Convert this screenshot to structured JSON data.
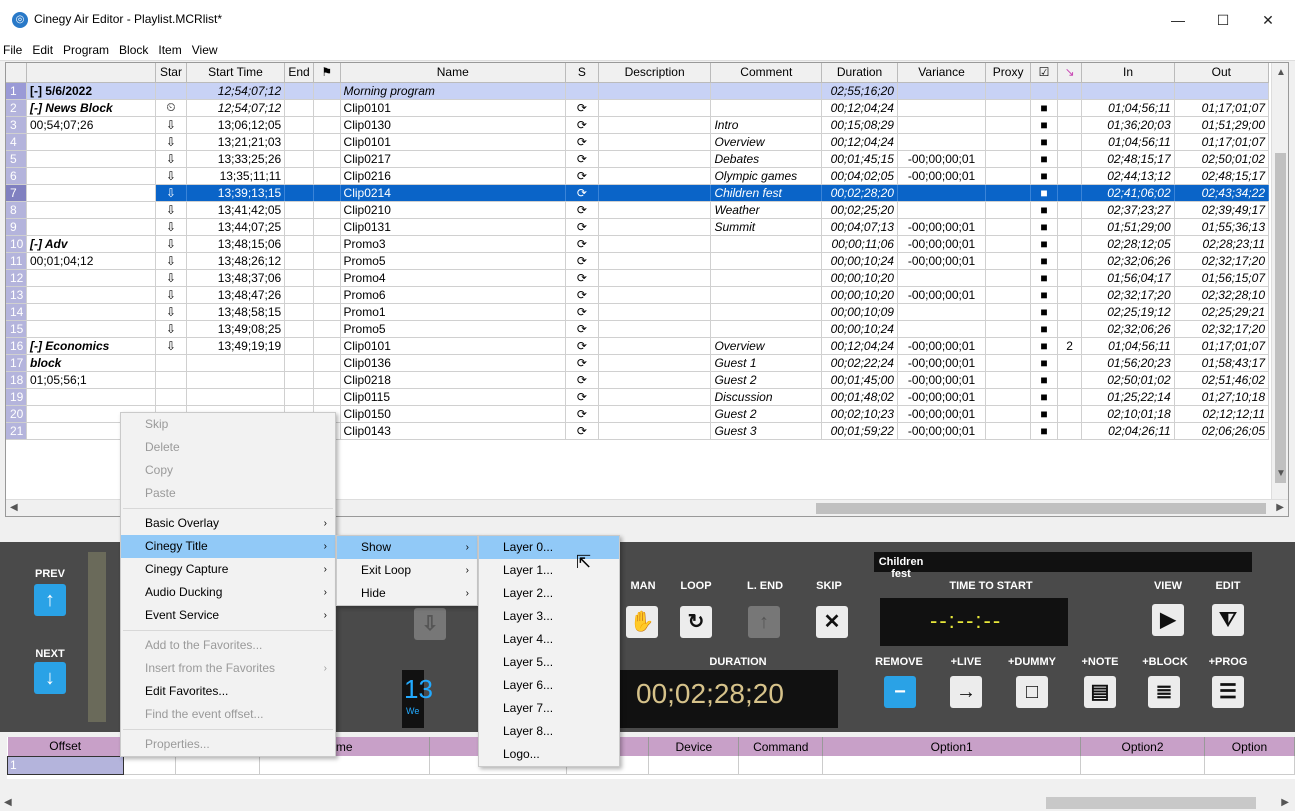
{
  "window": {
    "title": "Cinegy Air Editor - Playlist.MCRlist*",
    "minimize": "—",
    "maximize": "☐",
    "close": "✕"
  },
  "menubar": [
    "File",
    "Edit",
    "Program",
    "Block",
    "Item",
    "View"
  ],
  "columns": [
    "",
    "",
    "Star",
    "Start Time",
    "End",
    "",
    "Name",
    "S",
    "Description",
    "Comment",
    "Duration",
    "Variance",
    "Proxy",
    "☑",
    "",
    "In",
    "Out"
  ],
  "rows": [
    {
      "n": "1",
      "group": "[-] 5/6/2022",
      "star": "",
      "start": "12;54;07;12",
      "name": "Morning program",
      "s": "",
      "comment": "",
      "duration": "02;55;16;20",
      "variance": "",
      "chk": "",
      "ext": "",
      "in": "",
      "out": "",
      "type": "grp"
    },
    {
      "n": "2",
      "group": "[-] News Block",
      "star": "⏲",
      "start": "12;54;07;12",
      "name": "Clip0101",
      "s": "⟳",
      "comment": "",
      "duration": "00;12;04;24",
      "variance": "",
      "chk": "■",
      "ext": "",
      "in": "01;04;56;11",
      "out": "01;17;01;07",
      "type": "first"
    },
    {
      "n": "3",
      "group": "00;54;07;26",
      "star": "⇩",
      "start": "13;06;12;05",
      "name": "Clip0130",
      "s": "⟳",
      "comment": "Intro",
      "duration": "00;15;08;29",
      "variance": "",
      "chk": "■",
      "ext": "",
      "in": "01;36;20;03",
      "out": "01;51;29;00"
    },
    {
      "n": "4",
      "group": "",
      "star": "⇩",
      "start": "13;21;21;03",
      "name": "Clip0101",
      "s": "⟳",
      "comment": "Overview",
      "duration": "00;12;04;24",
      "variance": "",
      "chk": "■",
      "ext": "",
      "in": "01;04;56;11",
      "out": "01;17;01;07"
    },
    {
      "n": "5",
      "group": "",
      "star": "⇩",
      "start": "13;33;25;26",
      "name": "Clip0217",
      "s": "⟳",
      "comment": "Debates",
      "duration": "00;01;45;15",
      "variance": "-00;00;00;01",
      "chk": "■",
      "ext": "",
      "in": "02;48;15;17",
      "out": "02;50;01;02"
    },
    {
      "n": "6",
      "group": "",
      "star": "⇩",
      "start": "13;35;11;11",
      "name": "Clip0216",
      "s": "⟳",
      "comment": "Olympic games",
      "duration": "00;04;02;05",
      "variance": "-00;00;00;01",
      "chk": "■",
      "ext": "",
      "in": "02;44;13;12",
      "out": "02;48;15;17"
    },
    {
      "n": "7",
      "group": "",
      "star": "⇩",
      "start": "13;39;13;15",
      "name": "Clip0214",
      "s": "⟳",
      "comment": "Children fest",
      "duration": "00;02;28;20",
      "variance": "",
      "chk": "■",
      "ext": "",
      "in": "02;41;06;02",
      "out": "02;43;34;22",
      "type": "sel"
    },
    {
      "n": "8",
      "group": "",
      "star": "⇩",
      "start": "13;41;42;05",
      "name": "Clip0210",
      "s": "⟳",
      "comment": "Weather",
      "duration": "00;02;25;20",
      "variance": "",
      "chk": "■",
      "ext": "",
      "in": "02;37;23;27",
      "out": "02;39;49;17"
    },
    {
      "n": "9",
      "group": "",
      "star": "⇩",
      "start": "13;44;07;25",
      "name": "Clip0131",
      "s": "⟳",
      "comment": "Summit",
      "duration": "00;04;07;13",
      "variance": "-00;00;00;01",
      "chk": "■",
      "ext": "",
      "in": "01;51;29;00",
      "out": "01;55;36;13"
    },
    {
      "n": "10",
      "group": "[-] Adv",
      "star": "⇩",
      "start": "13;48;15;06",
      "name": "Promo3",
      "s": "⟳",
      "comment": "",
      "duration": "00;00;11;06",
      "variance": "-00;00;00;01",
      "chk": "■",
      "ext": "",
      "in": "02;28;12;05",
      "out": "02;28;23;11",
      "type": "first"
    },
    {
      "n": "11",
      "group": "00;01;04;12",
      "star": "⇩",
      "start": "13;48;26;12",
      "name": "Promo5",
      "s": "⟳",
      "comment": "",
      "duration": "00;00;10;24",
      "variance": "-00;00;00;01",
      "chk": "■",
      "ext": "",
      "in": "02;32;06;26",
      "out": "02;32;17;20"
    },
    {
      "n": "12",
      "group": "",
      "star": "⇩",
      "start": "13;48;37;06",
      "name": "Promo4",
      "s": "⟳",
      "comment": "",
      "duration": "00;00;10;20",
      "variance": "",
      "chk": "■",
      "ext": "",
      "in": "01;56;04;17",
      "out": "01;56;15;07"
    },
    {
      "n": "13",
      "group": "",
      "star": "⇩",
      "start": "13;48;47;26",
      "name": "Promo6",
      "s": "⟳",
      "comment": "",
      "duration": "00;00;10;20",
      "variance": "-00;00;00;01",
      "chk": "■",
      "ext": "",
      "in": "02;32;17;20",
      "out": "02;32;28;10"
    },
    {
      "n": "14",
      "group": "",
      "star": "⇩",
      "start": "13;48;58;15",
      "name": "Promo1",
      "s": "⟳",
      "comment": "",
      "duration": "00;00;10;09",
      "variance": "",
      "chk": "■",
      "ext": "",
      "in": "02;25;19;12",
      "out": "02;25;29;21"
    },
    {
      "n": "15",
      "group": "",
      "star": "⇩",
      "start": "13;49;08;25",
      "name": "Promo5",
      "s": "⟳",
      "comment": "",
      "duration": "00;00;10;24",
      "variance": "",
      "chk": "■",
      "ext": "",
      "in": "02;32;06;26",
      "out": "02;32;17;20"
    },
    {
      "n": "16",
      "group": "[-] Economics",
      "star": "⇩",
      "start": "13;49;19;19",
      "name": "Clip0101",
      "s": "⟳",
      "comment": "Overview",
      "duration": "00;12;04;24",
      "variance": "-00;00;00;01",
      "chk": "■",
      "ext": "2",
      "in": "01;04;56;11",
      "out": "01;17;01;07",
      "type": "first"
    },
    {
      "n": "17",
      "group": "block",
      "star": "",
      "start": "",
      "name": "Clip0136",
      "s": "⟳",
      "comment": "Guest 1",
      "duration": "00;02;22;24",
      "variance": "-00;00;00;01",
      "chk": "■",
      "ext": "",
      "in": "01;56;20;23",
      "out": "01;58;43;17",
      "type": "first"
    },
    {
      "n": "18",
      "group": "01;05;56;1",
      "star": "",
      "start": "",
      "name": "Clip0218",
      "s": "⟳",
      "comment": "Guest 2",
      "duration": "00;01;45;00",
      "variance": "-00;00;00;01",
      "chk": "■",
      "ext": "",
      "in": "02;50;01;02",
      "out": "02;51;46;02"
    },
    {
      "n": "19",
      "group": "",
      "star": "",
      "start": "",
      "name": "Clip0115",
      "s": "⟳",
      "comment": "Discussion",
      "duration": "00;01;48;02",
      "variance": "-00;00;00;01",
      "chk": "■",
      "ext": "",
      "in": "01;25;22;14",
      "out": "01;27;10;18"
    },
    {
      "n": "20",
      "group": "",
      "star": "",
      "start": "",
      "name": "Clip0150",
      "s": "⟳",
      "comment": "Guest 2",
      "duration": "00;02;10;23",
      "variance": "-00;00;00;01",
      "chk": "■",
      "ext": "",
      "in": "02;10;01;18",
      "out": "02;12;12;11"
    },
    {
      "n": "21",
      "group": "",
      "star": "",
      "start": "",
      "name": "Clip0143",
      "s": "⟳",
      "comment": "Guest 3",
      "duration": "00;01;59;22",
      "variance": "-00;00;00;01",
      "chk": "■",
      "ext": "",
      "in": "02;04;26;11",
      "out": "02;06;26;05"
    }
  ],
  "control": {
    "prev": "PREV",
    "next": "NEXT",
    "time_partial": "13",
    "day_partial": "We",
    "modes": [
      "MAN",
      "LOOP",
      "L. END",
      "SKIP"
    ],
    "current_title": "Children fest",
    "time_to_start_label": "TIME TO START",
    "time_to_start": "--:--:--",
    "duration_label": "DURATION",
    "duration": "00;02;28;20",
    "view": "VIEW",
    "edit": "EDIT",
    "actions": [
      "REMOVE",
      "+LIVE",
      "+DUMMY",
      "+NOTE",
      "+BLOCK",
      "+PROG"
    ]
  },
  "bottom_columns": [
    "Offset",
    "",
    "",
    "me",
    "",
    "",
    "Device",
    "Command",
    "Option1",
    "Option2",
    "Option"
  ],
  "bottom_row": "1",
  "context_menu": {
    "items": [
      {
        "label": "Skip",
        "disabled": true
      },
      {
        "label": "Delete",
        "disabled": true
      },
      {
        "label": "Copy",
        "disabled": true
      },
      {
        "label": "Paste",
        "disabled": true
      },
      {
        "sep": true
      },
      {
        "label": "Basic Overlay",
        "sub": true
      },
      {
        "label": "Cinegy Title",
        "sub": true,
        "hover": true
      },
      {
        "label": "Cinegy Capture",
        "sub": true
      },
      {
        "label": "Audio Ducking",
        "sub": true
      },
      {
        "label": "Event Service",
        "sub": true
      },
      {
        "sep": true
      },
      {
        "label": "Add to the Favorites...",
        "disabled": true
      },
      {
        "label": "Insert from the Favorites",
        "disabled": true,
        "sub": true
      },
      {
        "label": "Edit Favorites..."
      },
      {
        "label": "Find the event offset...",
        "disabled": true
      },
      {
        "sep": true
      },
      {
        "label": "Properties...",
        "disabled": true
      }
    ],
    "submenu1": [
      {
        "label": "Show",
        "hover": true
      },
      {
        "label": "Exit Loop"
      },
      {
        "label": "Hide"
      }
    ],
    "submenu2": [
      "Layer 0...",
      "Layer 1...",
      "Layer 2...",
      "Layer 3...",
      "Layer 4...",
      "Layer 5...",
      "Layer 6...",
      "Layer 7...",
      "Layer 8...",
      "Logo..."
    ]
  }
}
